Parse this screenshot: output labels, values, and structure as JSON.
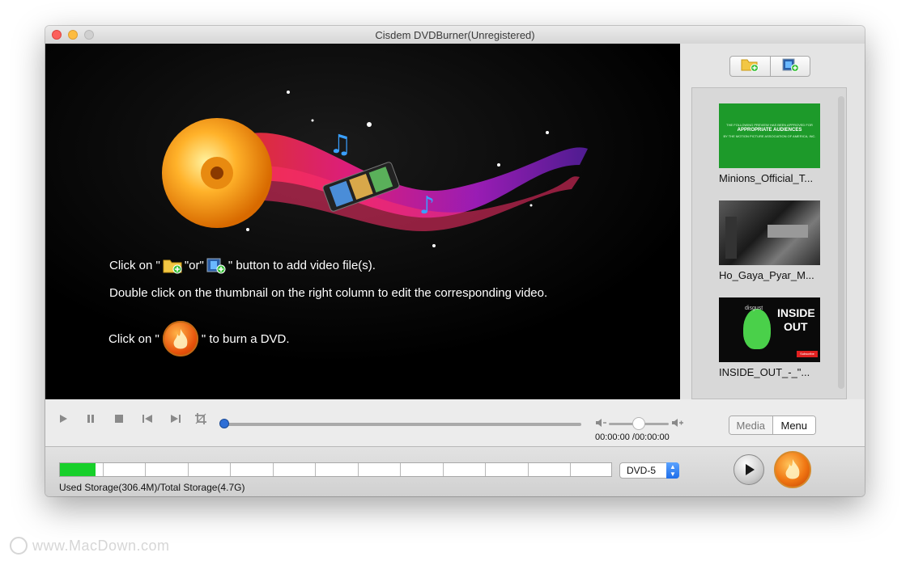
{
  "window": {
    "title": "Cisdem DVDBurner(Unregistered)"
  },
  "preview": {
    "line1_prefix": "Click on \"",
    "line1_or": "\"or\"",
    "line1_suffix": "\" button to add video file(s).",
    "line2": "Double click on the thumbnail on the right column to edit the corresponding video.",
    "line3_prefix": "Click on  \"",
    "line3_suffix": "\"  to burn a DVD."
  },
  "right_panel": {
    "add_folder_icon": "folder-add-icon",
    "add_video_icon": "film-add-icon",
    "thumbnails": [
      {
        "caption": "Minions_Official_T..."
      },
      {
        "caption": "Ho_Gaya_Pyar_M..."
      },
      {
        "caption": "INSIDE_OUT_-_\"..."
      }
    ],
    "thumb1_overlay": [
      "THE FOLLOWING PREVIEW HAS BEEN APPROVED FOR",
      "APPROPRIATE AUDIENCES",
      "BY THE MOTION PICTURE ASSOCIATION OF AMERICA, INC."
    ],
    "thumb3_overlay": [
      "disgust",
      "INSIDE",
      "OUT",
      "Subscribe"
    ]
  },
  "playback": {
    "time_current": "00:00:00",
    "time_total": "/00:00:00",
    "progress": 0,
    "volume": 0.5
  },
  "mode_toggle": {
    "media_label": "Media",
    "menu_label": "Menu",
    "selected": "Menu"
  },
  "storage": {
    "label": "Used Storage(306.4M)/Total Storage(4.7G)",
    "used_fraction": 0.065,
    "disc_type": "DVD-5"
  },
  "watermark": {
    "text": "www.MacDown.com"
  },
  "colors": {
    "storage_fill": "#17d02a",
    "thumb1_bg": "#1d9a2a",
    "accent_blue": "#2f6fd6"
  }
}
